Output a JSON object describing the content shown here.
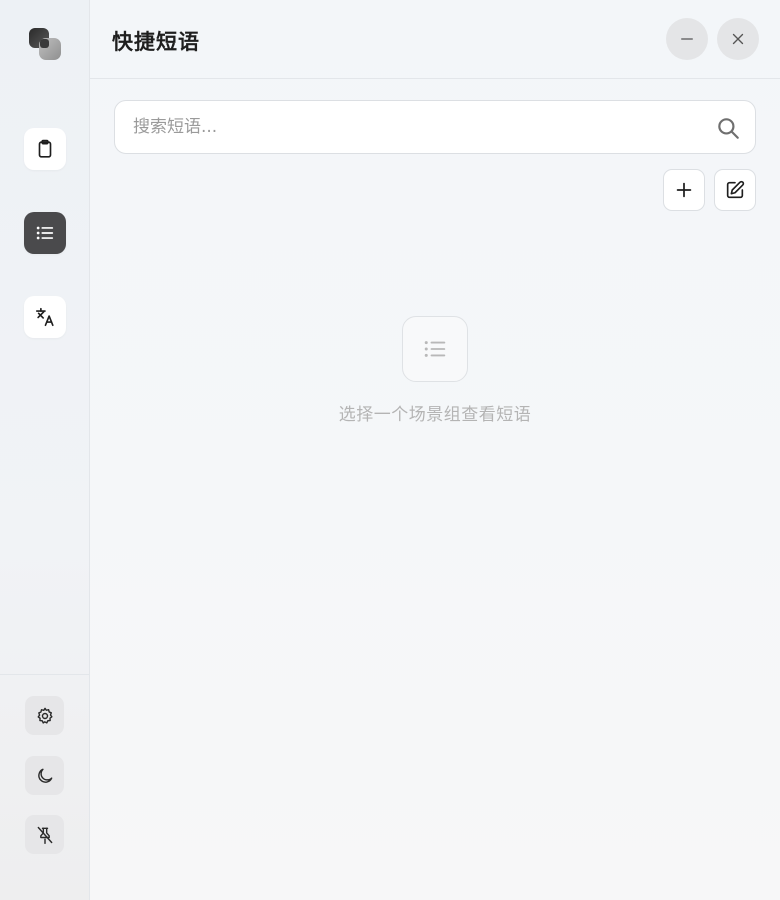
{
  "app": {
    "logo_icon": "app-logo-icon"
  },
  "sidebar": {
    "nav": [
      {
        "id": "clipboard",
        "icon": "clipboard-icon",
        "active": false
      },
      {
        "id": "phrases",
        "icon": "list-icon",
        "active": true
      },
      {
        "id": "translate",
        "icon": "translate-icon",
        "active": false
      }
    ],
    "utilities": [
      {
        "id": "settings",
        "icon": "gear-icon"
      },
      {
        "id": "theme",
        "icon": "moon-icon"
      },
      {
        "id": "pin",
        "icon": "pin-off-icon"
      }
    ]
  },
  "header": {
    "title": "快捷短语",
    "minimize_icon": "minus-icon",
    "close_icon": "close-icon"
  },
  "search": {
    "placeholder": "搜索短语...",
    "value": "",
    "icon": "search-icon"
  },
  "toolbar": {
    "add_icon": "plus-icon",
    "edit_icon": "edit-icon"
  },
  "empty_state": {
    "icon": "list-icon",
    "message": "选择一个场景组查看短语"
  },
  "colors": {
    "active_nav_bg": "#4a4a4c",
    "placeholder": "#9a9a9a",
    "empty_text": "#b4b4b4"
  }
}
